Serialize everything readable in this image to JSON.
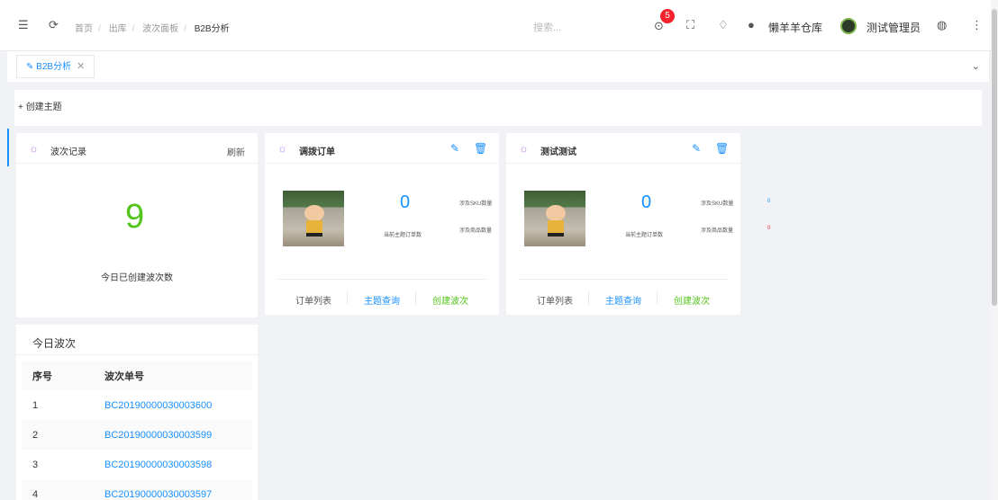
{
  "header": {
    "breadcrumbs": [
      "首页",
      "出库",
      "波次面板",
      "B2B分析"
    ],
    "search_placeholder": "搜索...",
    "notification_badge": "5",
    "warehouse": "懒羊羊仓库",
    "user": "测试管理员"
  },
  "tabs": [
    {
      "label": "B2B分析"
    }
  ],
  "create_topic": "+ 创建主题",
  "wave_card": {
    "title": "波次记录",
    "refresh": "刷新",
    "count": "9",
    "caption": "今日已创建波次数"
  },
  "topic_cards": [
    {
      "title": "调拨订单",
      "order_count": "0",
      "order_caption": "当前主题订单数",
      "sku_label": "涉及SKU数量",
      "sku_value": "",
      "goods_label": "涉及商品数量",
      "goods_value": "",
      "links": [
        "订单列表",
        "主题查询",
        "创建波次"
      ]
    },
    {
      "title": "测试测试",
      "order_count": "0",
      "order_caption": "当前主题订单数",
      "sku_label": "涉及SKU数量",
      "sku_value": "0",
      "goods_label": "涉及商品数量",
      "goods_value": "0",
      "links": [
        "订单列表",
        "主题查询",
        "创建波次"
      ]
    }
  ],
  "today_waves": {
    "title": "今日波次",
    "columns": [
      "序号",
      "波次单号"
    ],
    "rows": [
      {
        "no": "1",
        "code": "BC20190000030003600"
      },
      {
        "no": "2",
        "code": "BC20190000030003599"
      },
      {
        "no": "3",
        "code": "BC20190000030003598"
      },
      {
        "no": "4",
        "code": "BC20190000030003597"
      }
    ]
  },
  "colors": {
    "primary": "#1890ff",
    "green": "#52c41a",
    "badge": "#f5222d"
  },
  "icons": [
    "menu-fold-icon",
    "refresh-icon",
    "search-icon",
    "notification-icon",
    "fullscreen-icon",
    "bell-icon",
    "user-icon",
    "language-icon",
    "more-icon",
    "bulb-icon",
    "edit-icon",
    "delete-icon",
    "chevron-down-icon",
    "close-icon"
  ]
}
